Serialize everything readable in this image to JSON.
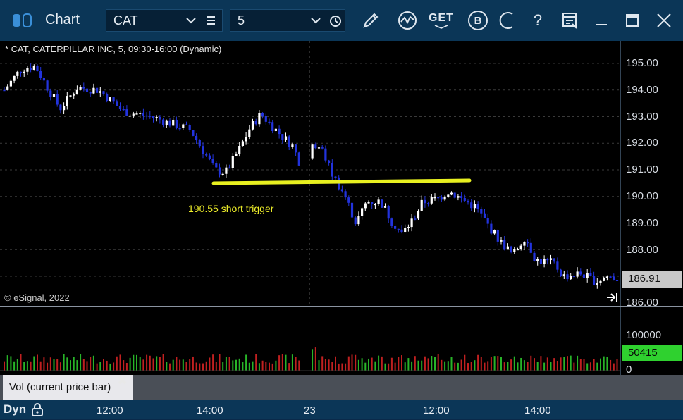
{
  "titlebar": {
    "title": "Chart",
    "symbol": "CAT",
    "interval": "5",
    "tool_labels": {
      "get": "GET",
      "b": "B",
      "help": "?"
    }
  },
  "chart": {
    "study_title": "* CAT, CATERPILLAR INC, 5, 09:30-16:00 (Dynamic)",
    "watermark": "© eSignal, 2022",
    "annotation": "190.55 short trigger",
    "price_ticks": [
      "195.00",
      "194.00",
      "193.00",
      "192.00",
      "191.00",
      "190.00",
      "189.00",
      "188.00",
      "187.00",
      "186.00"
    ],
    "last_price": "186.91",
    "trigger_price": 190.55
  },
  "volume": {
    "legend": "Vol (current price bar)",
    "ticks": [
      "100000",
      "0"
    ],
    "last": "50415"
  },
  "time_axis": {
    "dyn_label": "Dyn",
    "ticks": [
      "12:00",
      "14:00",
      "23",
      "12:00",
      "14:00"
    ]
  },
  "colors": {
    "bull": "#ffffff",
    "bear": "#2233dd",
    "trendline": "#e8f020",
    "vol_up": "#28b428",
    "vol_down": "#c02020",
    "last_volume_bg": "#2fd12f"
  }
}
